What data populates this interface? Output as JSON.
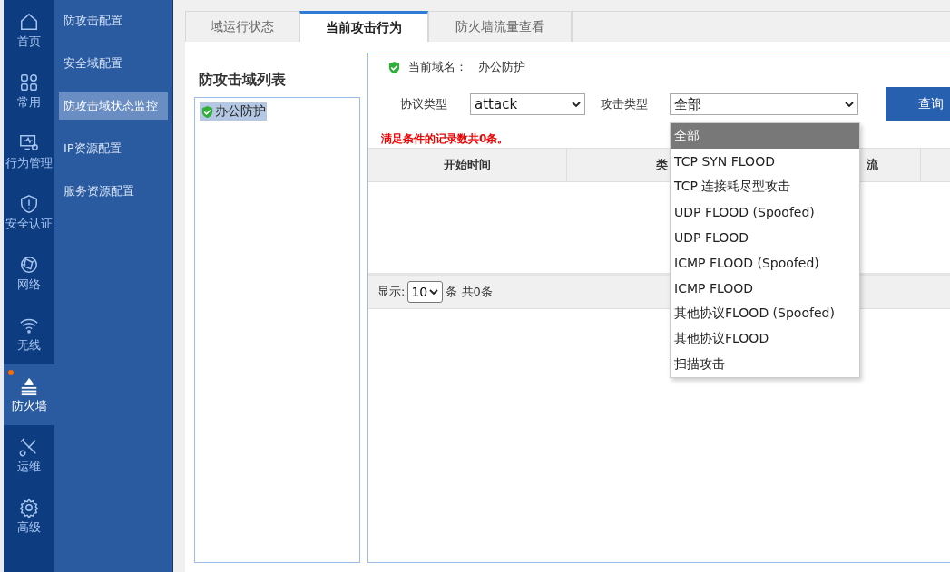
{
  "nav_rail": [
    {
      "label": "首页",
      "selected": false,
      "alert": false
    },
    {
      "label": "常用",
      "selected": false,
      "alert": false
    },
    {
      "label": "行为管理",
      "selected": false,
      "alert": false
    },
    {
      "label": "安全认证",
      "selected": false,
      "alert": false
    },
    {
      "label": "网络",
      "selected": false,
      "alert": false
    },
    {
      "label": "无线",
      "selected": false,
      "alert": false
    },
    {
      "label": "防火墙",
      "selected": true,
      "alert": true
    },
    {
      "label": "运维",
      "selected": false,
      "alert": false
    },
    {
      "label": "高级",
      "selected": false,
      "alert": false
    }
  ],
  "submenu": [
    {
      "label": "防攻击配置",
      "selected": false
    },
    {
      "label": "安全域配置",
      "selected": false
    },
    {
      "label": "防攻击域状态监控",
      "selected": true
    },
    {
      "label": "IP资源配置",
      "selected": false
    },
    {
      "label": "服务资源配置",
      "selected": false
    }
  ],
  "tabs": [
    {
      "label": "域运行状态",
      "selected": false
    },
    {
      "label": "当前攻击行为",
      "selected": true
    },
    {
      "label": "防火墙流量查看",
      "selected": false
    }
  ],
  "domain_list": {
    "title": "防攻击域列表",
    "items": [
      {
        "label": "办公防护",
        "selected": true
      }
    ]
  },
  "current_domain": {
    "label": "当前域名：",
    "value": "办公防护"
  },
  "filters": {
    "protocol_label": "协议类型",
    "protocol_value": "attack",
    "attack_label": "攻击类型",
    "attack_value": "全部",
    "query_button": "查询"
  },
  "record_count": "满足条件的记录数共0条。",
  "table": {
    "columns": [
      "开始时间",
      "类",
      "流"
    ]
  },
  "pager": {
    "show_label": "显示:",
    "page_size": "10",
    "suffix": "条 共0条"
  },
  "attack_dropdown": [
    {
      "label": "全部",
      "selected": true
    },
    {
      "label": "TCP SYN FLOOD",
      "selected": false
    },
    {
      "label": "TCP 连接耗尽型攻击",
      "selected": false
    },
    {
      "label": "UDP FLOOD (Spoofed)",
      "selected": false
    },
    {
      "label": "UDP FLOOD",
      "selected": false
    },
    {
      "label": "ICMP FLOOD (Spoofed)",
      "selected": false
    },
    {
      "label": "ICMP FLOOD",
      "selected": false
    },
    {
      "label": "其他协议FLOOD (Spoofed)",
      "selected": false
    },
    {
      "label": "其他协议FLOOD",
      "selected": false
    },
    {
      "label": "扫描攻击",
      "selected": false
    }
  ]
}
